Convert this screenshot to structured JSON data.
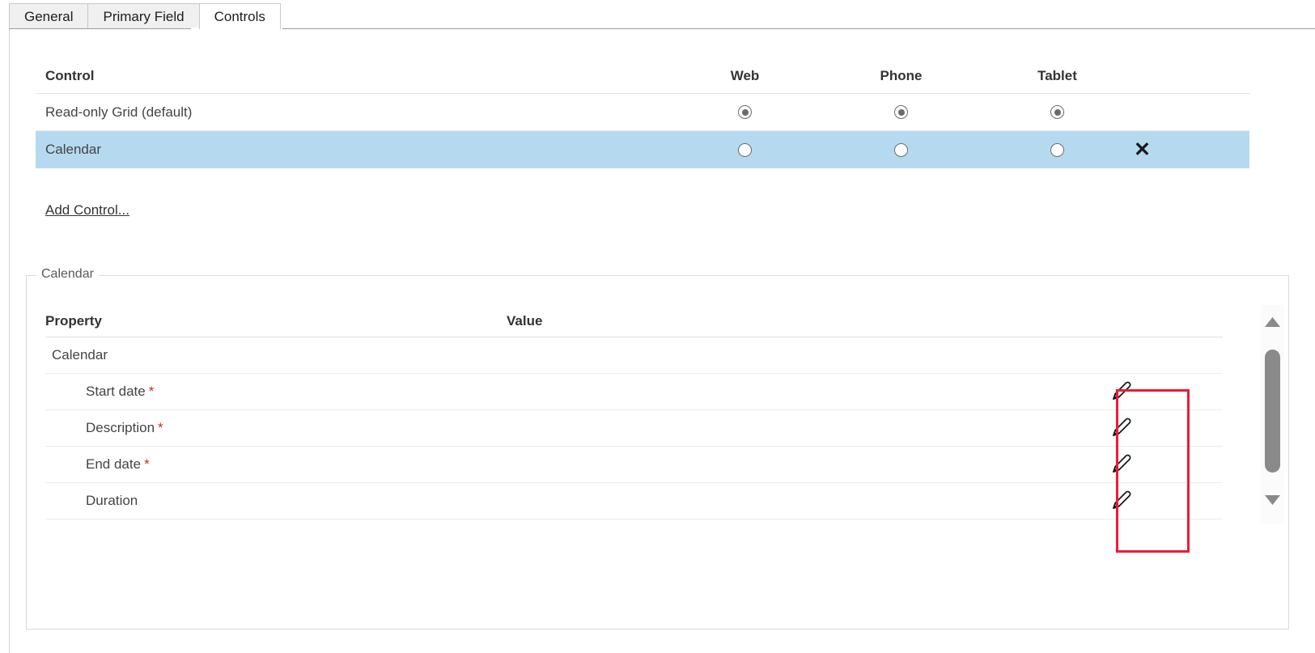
{
  "tabs": [
    {
      "label": "General",
      "active": false
    },
    {
      "label": "Primary Field",
      "active": false
    },
    {
      "label": "Controls",
      "active": true
    }
  ],
  "control_table": {
    "headers": {
      "control": "Control",
      "web": "Web",
      "phone": "Phone",
      "tablet": "Tablet"
    },
    "rows": [
      {
        "name": "Read-only Grid (default)",
        "web": "checked",
        "phone": "checked",
        "tablet": "checked",
        "selected": false,
        "delete_icon": "close-icon",
        "has_delete": false
      },
      {
        "name": "Calendar",
        "web": "unchecked",
        "phone": "unchecked",
        "tablet": "unchecked",
        "selected": true,
        "delete_icon": "✕",
        "has_delete": true
      }
    ],
    "add_control_label": "Add Control..."
  },
  "calendar_section": {
    "legend": "Calendar",
    "property_table": {
      "headers": {
        "property": "Property",
        "value": "Value"
      },
      "rows": [
        {
          "property": "Calendar",
          "required": false,
          "indent": 0,
          "value": "",
          "edit_icon": "pencil-icon",
          "has_edit": false
        },
        {
          "property": "Start date",
          "required": true,
          "indent": 1,
          "value": "",
          "edit_icon": "pencil-icon",
          "has_edit": true
        },
        {
          "property": "Description",
          "required": true,
          "indent": 1,
          "value": "",
          "edit_icon": "pencil-icon",
          "has_edit": true
        },
        {
          "property": "End date",
          "required": true,
          "indent": 1,
          "value": "",
          "edit_icon": "pencil-icon",
          "has_edit": true
        },
        {
          "property": "Duration",
          "required": false,
          "indent": 1,
          "value": "",
          "edit_icon": "pencil-icon",
          "has_edit": true
        }
      ],
      "required_marker": "*"
    },
    "scrollbar": {
      "up_arrow_icon": "triangle-up-icon",
      "down_arrow_icon": "triangle-down-icon",
      "thumb_icon": "scroll-thumb"
    }
  },
  "annotation": {
    "highlight_color": "#ed1b36",
    "label": "edit-column-highlight"
  },
  "colors": {
    "selected_row": "#b5daf0",
    "required_star": "#d42a2a",
    "highlight": "#ed1b36",
    "scrollbar_thumb": "#8a8a8a"
  }
}
